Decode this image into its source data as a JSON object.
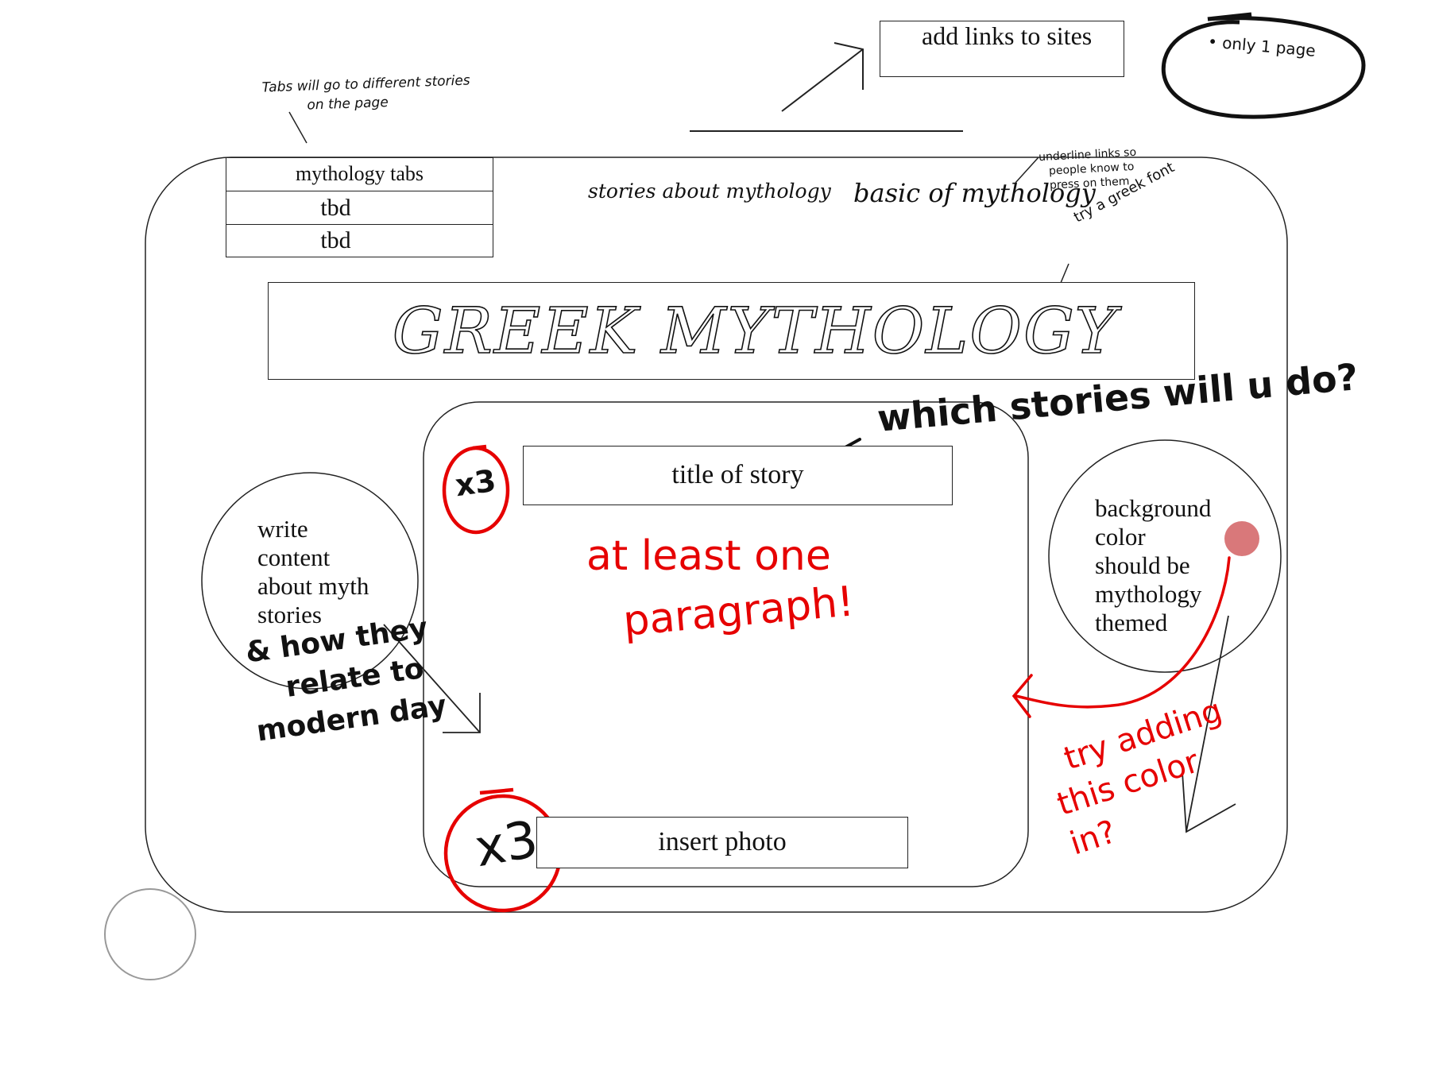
{
  "top_links_box": {
    "label": "add links to sites"
  },
  "only_page_note": {
    "text": "• only 1 page"
  },
  "tabs_note": {
    "line1": "Tabs will go to different stories",
    "line2": "on the page"
  },
  "underline_note": {
    "line1": "underline links so",
    "line2": "people know to",
    "line3": "press on them"
  },
  "font_note": {
    "text": "try a greek font"
  },
  "mythology_tabs": {
    "header": "mythology tabs",
    "items": [
      "tbd",
      "tbd"
    ]
  },
  "nav_links": [
    "stories about mythology",
    "basic of mythology"
  ],
  "title": "GREEK MYTHOLOGY",
  "story_title_box": {
    "label": "title of story"
  },
  "insert_photo_box": {
    "label": "insert photo"
  },
  "multiplier_badges": [
    "x3",
    "x3"
  ],
  "paragraph_note": {
    "line1": "at least one",
    "line2": "paragraph!"
  },
  "which_stories_note": {
    "text": "which stories will u do?"
  },
  "write_content_circle": {
    "lines": [
      "write",
      "content",
      "about myth",
      "stories"
    ]
  },
  "modern_day_note": {
    "lines": [
      "& how they",
      "relate to",
      "modern day"
    ]
  },
  "background_circle": {
    "lines": [
      "background",
      "color",
      "should be",
      "mythology",
      "themed"
    ]
  },
  "color_note": {
    "lines": [
      "try adding",
      "this color",
      "in?"
    ]
  },
  "colors": {
    "ink": "#111111",
    "red_ink": "#e60000",
    "swatch": "#d9787a",
    "grey_circle": "#999999"
  }
}
